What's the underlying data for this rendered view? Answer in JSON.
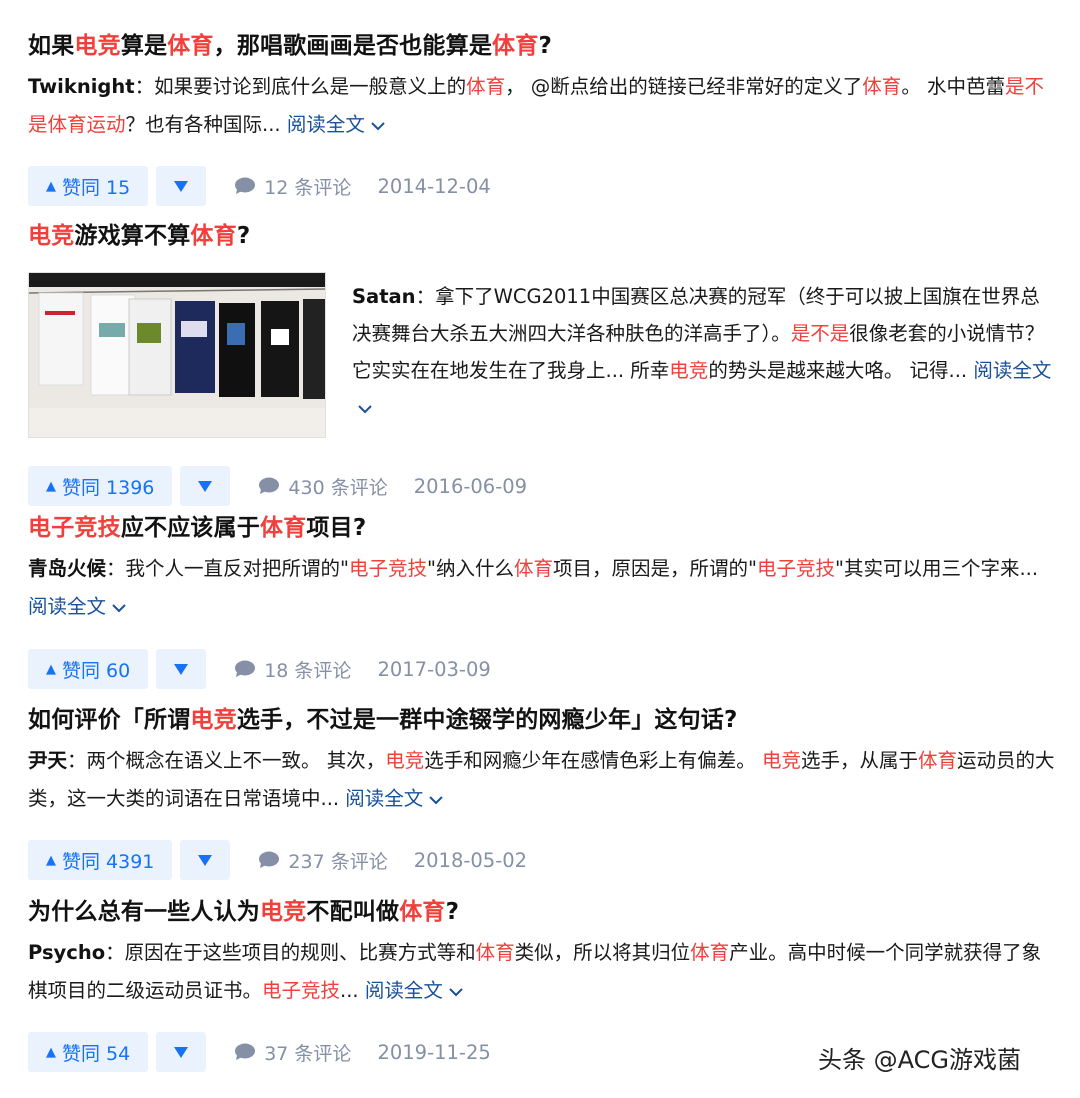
{
  "items": [
    {
      "title": [
        {
          "t": "如果",
          "hl": false
        },
        {
          "t": "电竞",
          "hl": true
        },
        {
          "t": "算是",
          "hl": false
        },
        {
          "t": "体育",
          "hl": true
        },
        {
          "t": "，那唱歌画画是否也能算是",
          "hl": false
        },
        {
          "t": "体育",
          "hl": true
        },
        {
          "t": "?",
          "hl": false
        }
      ],
      "author": "Twiknight",
      "excerpt": [
        {
          "t": "：如果要讨论到底什么是一般意义上的",
          "hl": false
        },
        {
          "t": "体育",
          "hl": true
        },
        {
          "t": "， @断点给出的链接已经非常好的定义了",
          "hl": false
        },
        {
          "t": "体育",
          "hl": true
        },
        {
          "t": "。 水中芭蕾",
          "hl": false
        },
        {
          "t": "是不是体育运动",
          "hl": true
        },
        {
          "t": "？也有各种国际... ",
          "hl": false
        }
      ],
      "read_more": "阅读全文",
      "vote_label": "赞同 15",
      "comments": "12 条评论",
      "date": "2014-12-04"
    },
    {
      "title": [
        {
          "t": "电竞",
          "hl": true
        },
        {
          "t": "游戏算不算",
          "hl": false
        },
        {
          "t": "体育",
          "hl": true
        },
        {
          "t": "?",
          "hl": false
        }
      ],
      "author": "Satan",
      "excerpt": [
        {
          "t": "：拿下了WCG2011中国赛区总决赛的冠军（终于可以披上国旗在世界总决赛舞台大杀五大洲四大洋各种肤色的洋高手了）。",
          "hl": false
        },
        {
          "t": "是不是",
          "hl": true
        },
        {
          "t": "很像老套的小说情节？它实实在在地发生在了我身上... 所幸",
          "hl": false
        },
        {
          "t": "电竞",
          "hl": true
        },
        {
          "t": "的势头是越来越大咯。 记得... ",
          "hl": false
        }
      ],
      "read_more": "阅读全文",
      "vote_label": "赞同 1396",
      "comments": "430 条评论",
      "date": "2016-06-09"
    },
    {
      "title": [
        {
          "t": "电子竞技",
          "hl": true
        },
        {
          "t": "应不应该属于",
          "hl": false
        },
        {
          "t": "体育",
          "hl": true
        },
        {
          "t": "项目?",
          "hl": false
        }
      ],
      "author": "青岛火候",
      "excerpt": [
        {
          "t": "：我个人一直反对把所谓的\"",
          "hl": false
        },
        {
          "t": "电子竞技",
          "hl": true
        },
        {
          "t": "\"纳入什么",
          "hl": false
        },
        {
          "t": "体育",
          "hl": true
        },
        {
          "t": "项目，原因是，所谓的\"",
          "hl": false
        },
        {
          "t": "电子竞技",
          "hl": true
        },
        {
          "t": "\"其实可以用三个字来... ",
          "hl": false
        }
      ],
      "read_more": "阅读全文",
      "vote_label": "赞同 60",
      "comments": "18 条评论",
      "date": "2017-03-09"
    },
    {
      "title": [
        {
          "t": "如何评价「所谓",
          "hl": false
        },
        {
          "t": "电竞",
          "hl": true
        },
        {
          "t": "选手，不过是一群中途辍学的网瘾少年」这句话?",
          "hl": false
        }
      ],
      "author": "尹天",
      "excerpt": [
        {
          "t": "：两个概念在语义上不一致。 其次，",
          "hl": false
        },
        {
          "t": "电竞",
          "hl": true
        },
        {
          "t": "选手和网瘾少年在感情色彩上有偏差。 ",
          "hl": false
        },
        {
          "t": "电竞",
          "hl": true
        },
        {
          "t": "选手，从属于",
          "hl": false
        },
        {
          "t": "体育",
          "hl": true
        },
        {
          "t": "运动员的大类，这一大类的词语在日常语境中... ",
          "hl": false
        }
      ],
      "read_more": "阅读全文",
      "vote_label": "赞同 4391",
      "comments": "237 条评论",
      "date": "2018-05-02"
    },
    {
      "title": [
        {
          "t": "为什么总有一些人认为",
          "hl": false
        },
        {
          "t": "电竞",
          "hl": true
        },
        {
          "t": "不配叫做",
          "hl": false
        },
        {
          "t": "体育",
          "hl": true
        },
        {
          "t": "?",
          "hl": false
        }
      ],
      "author": "Psycho",
      "excerpt": [
        {
          "t": "：原因在于这些项目的规则、比赛方式等和",
          "hl": false
        },
        {
          "t": "体育",
          "hl": true
        },
        {
          "t": "类似，所以将其归位",
          "hl": false
        },
        {
          "t": "体育",
          "hl": true
        },
        {
          "t": "产业。高中时候一个同学就获得了象棋项目的二级运动员证书。",
          "hl": false
        },
        {
          "t": "电子竞技",
          "hl": true
        },
        {
          "t": "... ",
          "hl": false
        }
      ],
      "read_more": "阅读全文",
      "vote_label": "赞同 54",
      "comments": "37 条评论",
      "date": "2019-11-25"
    }
  ],
  "watermark": "头条 @ACG游戏菌",
  "colors": {
    "highlight": "#f1403c",
    "link": "#175199",
    "vote_bg": "#eaf2fd",
    "vote_fg": "#1772f6",
    "meta": "#8590a6"
  }
}
